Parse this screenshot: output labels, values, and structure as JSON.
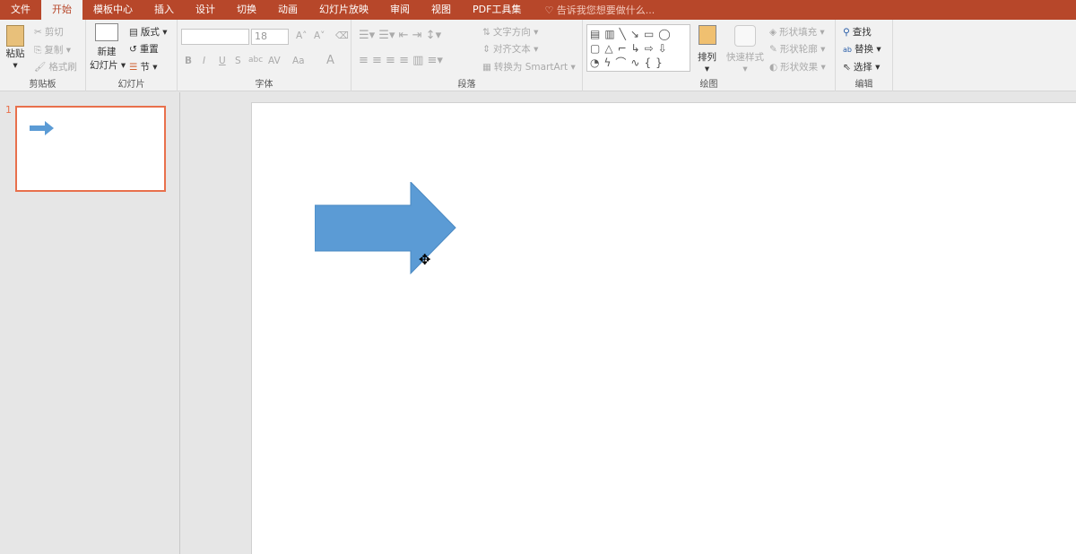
{
  "tabs": [
    "文件",
    "开始",
    "模板中心",
    "插入",
    "设计",
    "切换",
    "动画",
    "幻灯片放映",
    "审阅",
    "视图",
    "PDF工具集"
  ],
  "active_tab": "开始",
  "tell_me": "告诉我您想要做什么...",
  "clipboard": {
    "paste": "粘贴",
    "cut": "剪切",
    "copy": "复制",
    "format_painter": "格式刷",
    "label": "剪贴板"
  },
  "slides": {
    "new_slide": "新建",
    "new_slide2": "幻灯片",
    "layout": "版式",
    "reset": "重置",
    "section": "节",
    "label": "幻灯片"
  },
  "font": {
    "font_name": "",
    "font_size": "18",
    "bold": "B",
    "italic": "I",
    "underline": "U",
    "shadow": "S",
    "strike": "abc",
    "spacing": "AV",
    "case": "Aa",
    "color": "A",
    "grow": "A˄",
    "shrink": "A˅",
    "label": "字体"
  },
  "paragraph": {
    "text_direction": "文字方向",
    "align_text": "对齐文本",
    "smartart": "转换为 SmartArt",
    "label": "段落"
  },
  "drawing": {
    "arrange": "排列",
    "quick_styles": "快速样式",
    "fill": "形状填充",
    "outline": "形状轮廓",
    "effects": "形状效果",
    "label": "绘图"
  },
  "editing": {
    "find": "查找",
    "replace": "替换",
    "select": "选择",
    "label": "编辑"
  },
  "thumbnails": [
    {
      "number": "1"
    }
  ],
  "colors": {
    "accent": "#b7472a",
    "shape": "#5b9bd5",
    "thumb_border": "#e8704c"
  }
}
